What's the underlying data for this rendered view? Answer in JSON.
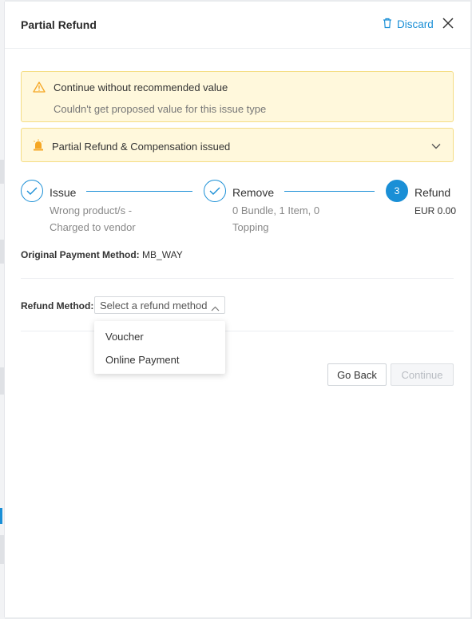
{
  "header": {
    "title": "Partial Refund",
    "discard_label": "Discard"
  },
  "alerts": {
    "warning_title": "Continue without recommended value",
    "warning_detail": "Couldn't get proposed value for this issue type",
    "info_title": "Partial Refund & Compensation issued"
  },
  "steps": [
    {
      "label": "Issue",
      "desc1": "Wrong product/s -",
      "desc2": "Charged to vendor",
      "state": "done"
    },
    {
      "label": "Remove",
      "desc1": "0 Bundle, 1 Item, 0",
      "desc2": "Topping",
      "state": "done"
    },
    {
      "label": "Refund",
      "number": "3",
      "amount": "EUR 0.00",
      "state": "active"
    }
  ],
  "payment": {
    "label": "Original Payment Method:",
    "value": "MB_WAY"
  },
  "refund_method": {
    "label": "Refund Method:",
    "placeholder": "Select a refund method",
    "options": [
      "Voucher",
      "Online Payment"
    ]
  },
  "buttons": {
    "back": "Go Back",
    "continue": "Continue"
  },
  "colors": {
    "accent": "#1a8fd6",
    "warning_bg": "#fff8dc",
    "warning_border": "#f5dd84",
    "warning_icon": "#f5a623"
  }
}
